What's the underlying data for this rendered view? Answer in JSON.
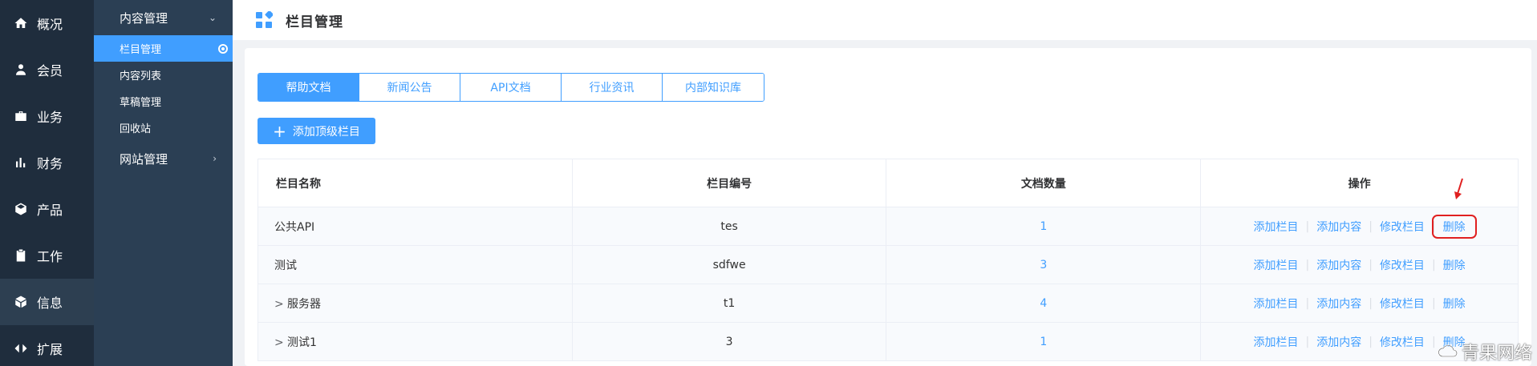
{
  "nav": {
    "items": [
      {
        "label": "概况",
        "icon": "home-icon"
      },
      {
        "label": "会员",
        "icon": "user-icon"
      },
      {
        "label": "业务",
        "icon": "briefcase-icon"
      },
      {
        "label": "财务",
        "icon": "bar-chart-icon"
      },
      {
        "label": "产品",
        "icon": "box-icon"
      },
      {
        "label": "工作",
        "icon": "clipboard-icon"
      },
      {
        "label": "信息",
        "icon": "cube-icon"
      },
      {
        "label": "扩展",
        "icon": "arrows-icon"
      }
    ],
    "active_index": 6
  },
  "subnav": {
    "group1": "内容管理",
    "items": [
      "栏目管理",
      "内容列表",
      "草稿管理",
      "回收站"
    ],
    "group2": "网站管理"
  },
  "header": {
    "title": "栏目管理"
  },
  "tabs": [
    "帮助文档",
    "新闻公告",
    "API文档",
    "行业资讯",
    "内部知识库"
  ],
  "add_button": {
    "plus": "+",
    "label": "添加顶级栏目"
  },
  "table": {
    "headers": [
      "栏目名称",
      "栏目编号",
      "文档数量",
      "操作"
    ],
    "rows": [
      {
        "expand": "",
        "name": "公共API",
        "code": "tes",
        "count": "1"
      },
      {
        "expand": "",
        "name": "测试",
        "code": "sdfwe",
        "count": "3"
      },
      {
        "expand": ">",
        "name": "服务器",
        "code": "t1",
        "count": "4"
      },
      {
        "expand": ">",
        "name": "测试1",
        "code": "3",
        "count": "1"
      }
    ],
    "ops": [
      "添加栏目",
      "添加内容",
      "修改栏目",
      "删除"
    ],
    "separator": "|"
  },
  "watermark": "青果网络",
  "colors": {
    "primary": "#409eff",
    "nav_bg": "#1f2d3d",
    "subnav_bg": "#2b3f54",
    "highlight": "#e02020"
  }
}
